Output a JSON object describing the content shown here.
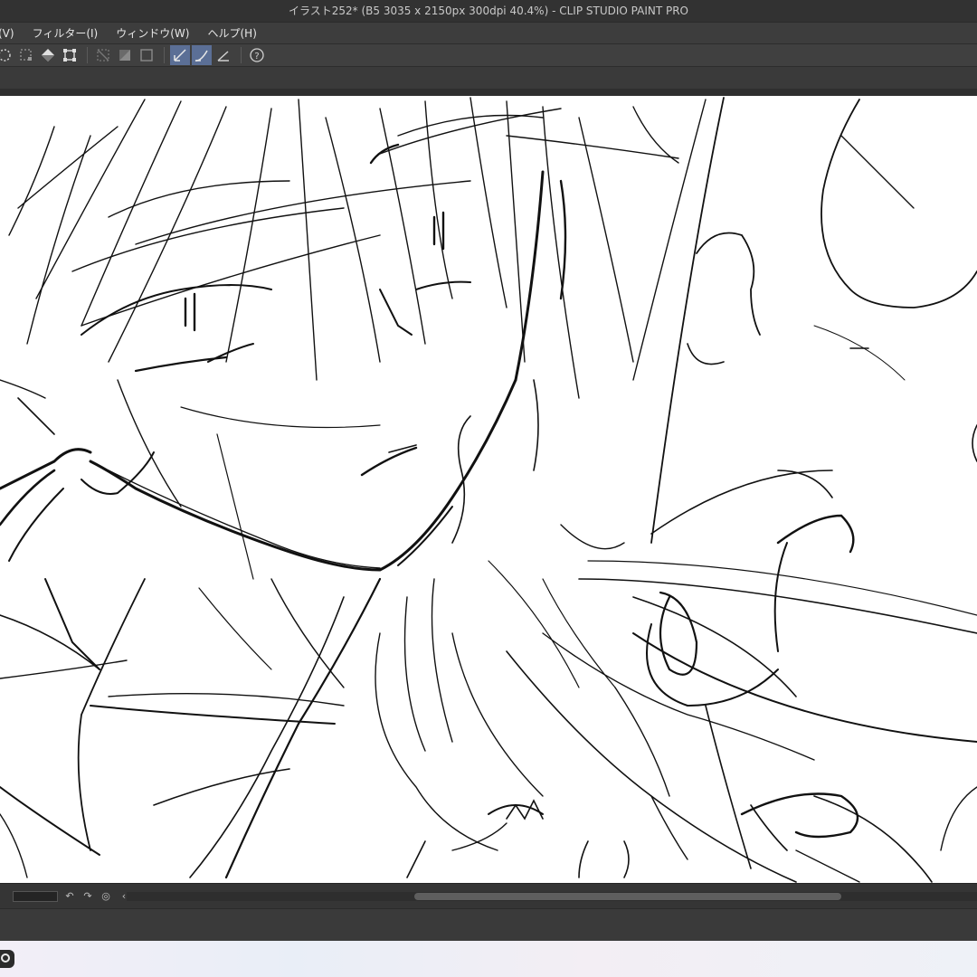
{
  "window": {
    "title": "イラスト252* (B5 3035 x 2150px 300dpi 40.4%)  - CLIP STUDIO PAINT PRO"
  },
  "menu": {
    "items": [
      {
        "label": "(V)"
      },
      {
        "label": "フィルター(I)"
      },
      {
        "label": "ウィンドウ(W)"
      },
      {
        "label": "ヘルプ(H)"
      }
    ]
  },
  "toolbar": {
    "icons": [
      "lasso-select-icon",
      "select-layer-icon",
      "fill-icon",
      "transform-icon",
      "clear-outside-icon",
      "invert-selection-icon",
      "show-selection-icon",
      "stabilizer-pen-icon",
      "stroke-smoothing-icon",
      "ruler-snap-icon",
      "help-icon"
    ]
  },
  "canvas": {
    "content": "rough line sketch of an anime-style character face with flowing hair"
  },
  "navigator": {
    "icons": [
      "undo-view-icon",
      "redo-view-icon",
      "rotate-reset-icon",
      "collapse-left-icon"
    ]
  },
  "colors": {
    "titlebar": "#323232",
    "menubar": "#3d3d3d",
    "toolbar": "#404040",
    "active_tool": "#5b6f96",
    "canvas": "#ffffff",
    "ink": "#111111"
  }
}
